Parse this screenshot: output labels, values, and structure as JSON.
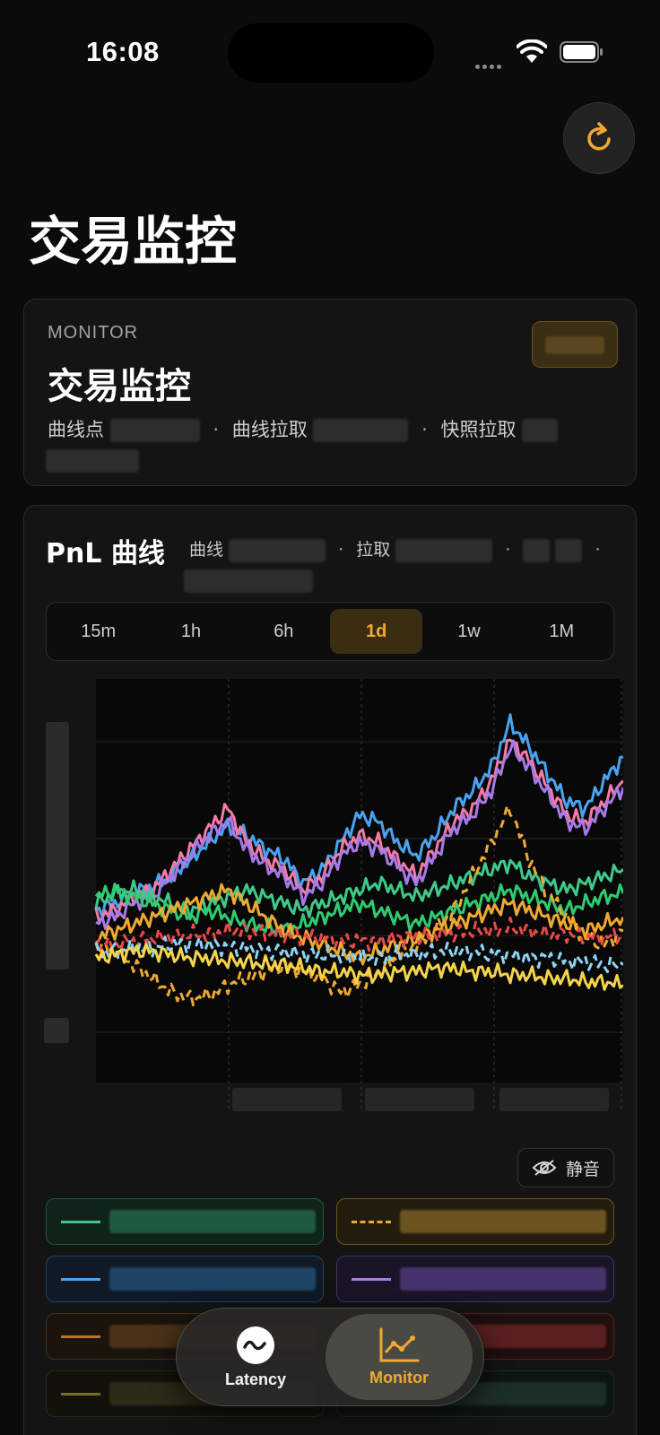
{
  "status_bar": {
    "time": "16:08"
  },
  "page": {
    "title": "交易监控"
  },
  "monitor_card": {
    "kicker": "MONITOR",
    "title": "交易监控",
    "meta_curve_points_label": "曲线点",
    "meta_curve_fetch_label": "曲线拉取",
    "meta_snapshot_fetch_label": "快照拉取",
    "separator": "·"
  },
  "pnl_card": {
    "title": "PnL 曲线",
    "meta_curve_label": "曲线",
    "meta_fetch_label": "拉取",
    "separator": "·",
    "ranges": [
      "15m",
      "1h",
      "6h",
      "1d",
      "1w",
      "1M"
    ],
    "active_range": "1d",
    "mute_label": "静音"
  },
  "colors": {
    "accent": "#f0a930",
    "series": [
      "#3fc98a",
      "#f0a930",
      "#4aa3f0",
      "#a77ae8",
      "#f47aa8",
      "#e84a4a",
      "#f5d44a",
      "#8ed3f5",
      "#2ecc71",
      "#f5a04a"
    ]
  },
  "legend": [
    {
      "color": "#3fc98a",
      "style": "solid",
      "border": "#1f5a40",
      "bg": "#0f2319"
    },
    {
      "color": "#f0a930",
      "style": "dashed",
      "border": "#6b5320",
      "bg": "#241d0e"
    },
    {
      "color": "#4aa3f0",
      "style": "solid",
      "border": "#1f4566",
      "bg": "#0f1a26"
    },
    {
      "color": "#a77ae8",
      "style": "solid",
      "border": "#45336b",
      "bg": "#1a1426"
    },
    {
      "color": "#b8742e",
      "style": "solid",
      "border": "#4a3218",
      "bg": "#1a140d"
    },
    {
      "color": "#e85a5a",
      "style": "solid",
      "border": "#5a2020",
      "bg": "#1f0f0f"
    },
    {
      "color": "#7a6a30",
      "style": "solid",
      "border": "#2e2a18",
      "bg": "#12110b"
    },
    {
      "color": "#3a6a5a",
      "style": "solid",
      "border": "#1c2e28",
      "bg": "#0e1411"
    }
  ],
  "nav": {
    "latency_label": "Latency",
    "monitor_label": "Monitor"
  },
  "chart_data": {
    "type": "line",
    "title": "PnL 曲线",
    "xlabel": "",
    "ylabel": "",
    "grid": true,
    "series": [
      {
        "color": "#4aa3f0",
        "style": "solid",
        "values": [
          0.4,
          0.42,
          0.45,
          0.47,
          0.5,
          0.55,
          0.6,
          0.65,
          0.62,
          0.58,
          0.55,
          0.48,
          0.52,
          0.6,
          0.68,
          0.66,
          0.6,
          0.56,
          0.62,
          0.7,
          0.75,
          0.82,
          0.95,
          0.88,
          0.8,
          0.72,
          0.7,
          0.78,
          0.85
        ]
      },
      {
        "color": "#f47aa8",
        "style": "solid",
        "values": [
          0.38,
          0.4,
          0.44,
          0.46,
          0.52,
          0.58,
          0.64,
          0.7,
          0.6,
          0.55,
          0.52,
          0.46,
          0.5,
          0.58,
          0.62,
          0.6,
          0.55,
          0.5,
          0.58,
          0.66,
          0.7,
          0.78,
          0.9,
          0.84,
          0.76,
          0.68,
          0.66,
          0.72,
          0.78
        ]
      },
      {
        "color": "#a77ae8",
        "style": "solid",
        "values": [
          0.36,
          0.38,
          0.42,
          0.44,
          0.5,
          0.56,
          0.62,
          0.66,
          0.58,
          0.53,
          0.5,
          0.44,
          0.48,
          0.56,
          0.6,
          0.58,
          0.53,
          0.48,
          0.56,
          0.64,
          0.68,
          0.75,
          0.88,
          0.82,
          0.74,
          0.66,
          0.64,
          0.7,
          0.76
        ]
      },
      {
        "color": "#3fc98a",
        "style": "solid",
        "values": [
          0.42,
          0.45,
          0.46,
          0.44,
          0.42,
          0.4,
          0.42,
          0.44,
          0.46,
          0.44,
          0.42,
          0.4,
          0.42,
          0.44,
          0.46,
          0.48,
          0.46,
          0.44,
          0.46,
          0.48,
          0.5,
          0.52,
          0.54,
          0.5,
          0.48,
          0.46,
          0.48,
          0.5,
          0.52
        ]
      },
      {
        "color": "#2ecc71",
        "style": "solid",
        "values": [
          0.44,
          0.46,
          0.44,
          0.42,
          0.4,
          0.38,
          0.4,
          0.38,
          0.36,
          0.35,
          0.34,
          0.36,
          0.38,
          0.4,
          0.42,
          0.4,
          0.38,
          0.36,
          0.38,
          0.4,
          0.42,
          0.44,
          0.46,
          0.44,
          0.42,
          0.4,
          0.42,
          0.44,
          0.45
        ]
      },
      {
        "color": "#f0a930",
        "style": "dashed",
        "values": [
          0.3,
          0.28,
          0.24,
          0.2,
          0.16,
          0.14,
          0.15,
          0.18,
          0.2,
          0.22,
          0.24,
          0.22,
          0.2,
          0.16,
          0.18,
          0.22,
          0.26,
          0.3,
          0.34,
          0.4,
          0.5,
          0.6,
          0.7,
          0.55,
          0.45,
          0.38,
          0.32,
          0.3,
          0.34
        ]
      },
      {
        "color": "#f0a930",
        "style": "solid",
        "values": [
          0.32,
          0.34,
          0.36,
          0.38,
          0.4,
          0.42,
          0.44,
          0.46,
          0.42,
          0.38,
          0.34,
          0.32,
          0.3,
          0.28,
          0.26,
          0.28,
          0.3,
          0.32,
          0.34,
          0.36,
          0.38,
          0.4,
          0.42,
          0.4,
          0.38,
          0.36,
          0.34,
          0.36,
          0.38
        ]
      },
      {
        "color": "#e84a4a",
        "style": "dashed",
        "values": [
          0.3,
          0.3,
          0.31,
          0.32,
          0.32,
          0.33,
          0.33,
          0.34,
          0.34,
          0.33,
          0.33,
          0.32,
          0.32,
          0.31,
          0.31,
          0.31,
          0.32,
          0.32,
          0.33,
          0.33,
          0.34,
          0.34,
          0.35,
          0.34,
          0.33,
          0.33,
          0.32,
          0.32,
          0.33
        ]
      },
      {
        "color": "#8ed3f5",
        "style": "dashed",
        "values": [
          0.28,
          0.28,
          0.29,
          0.29,
          0.3,
          0.3,
          0.3,
          0.29,
          0.29,
          0.28,
          0.28,
          0.27,
          0.27,
          0.27,
          0.26,
          0.26,
          0.27,
          0.27,
          0.28,
          0.28,
          0.28,
          0.27,
          0.27,
          0.26,
          0.26,
          0.25,
          0.25,
          0.24,
          0.24
        ]
      },
      {
        "color": "#f5d44a",
        "style": "solid",
        "values": [
          0.26,
          0.27,
          0.28,
          0.28,
          0.27,
          0.26,
          0.26,
          0.25,
          0.25,
          0.24,
          0.24,
          0.23,
          0.22,
          0.22,
          0.21,
          0.21,
          0.22,
          0.22,
          0.23,
          0.23,
          0.22,
          0.22,
          0.21,
          0.21,
          0.2,
          0.2,
          0.19,
          0.19,
          0.18
        ]
      }
    ]
  }
}
